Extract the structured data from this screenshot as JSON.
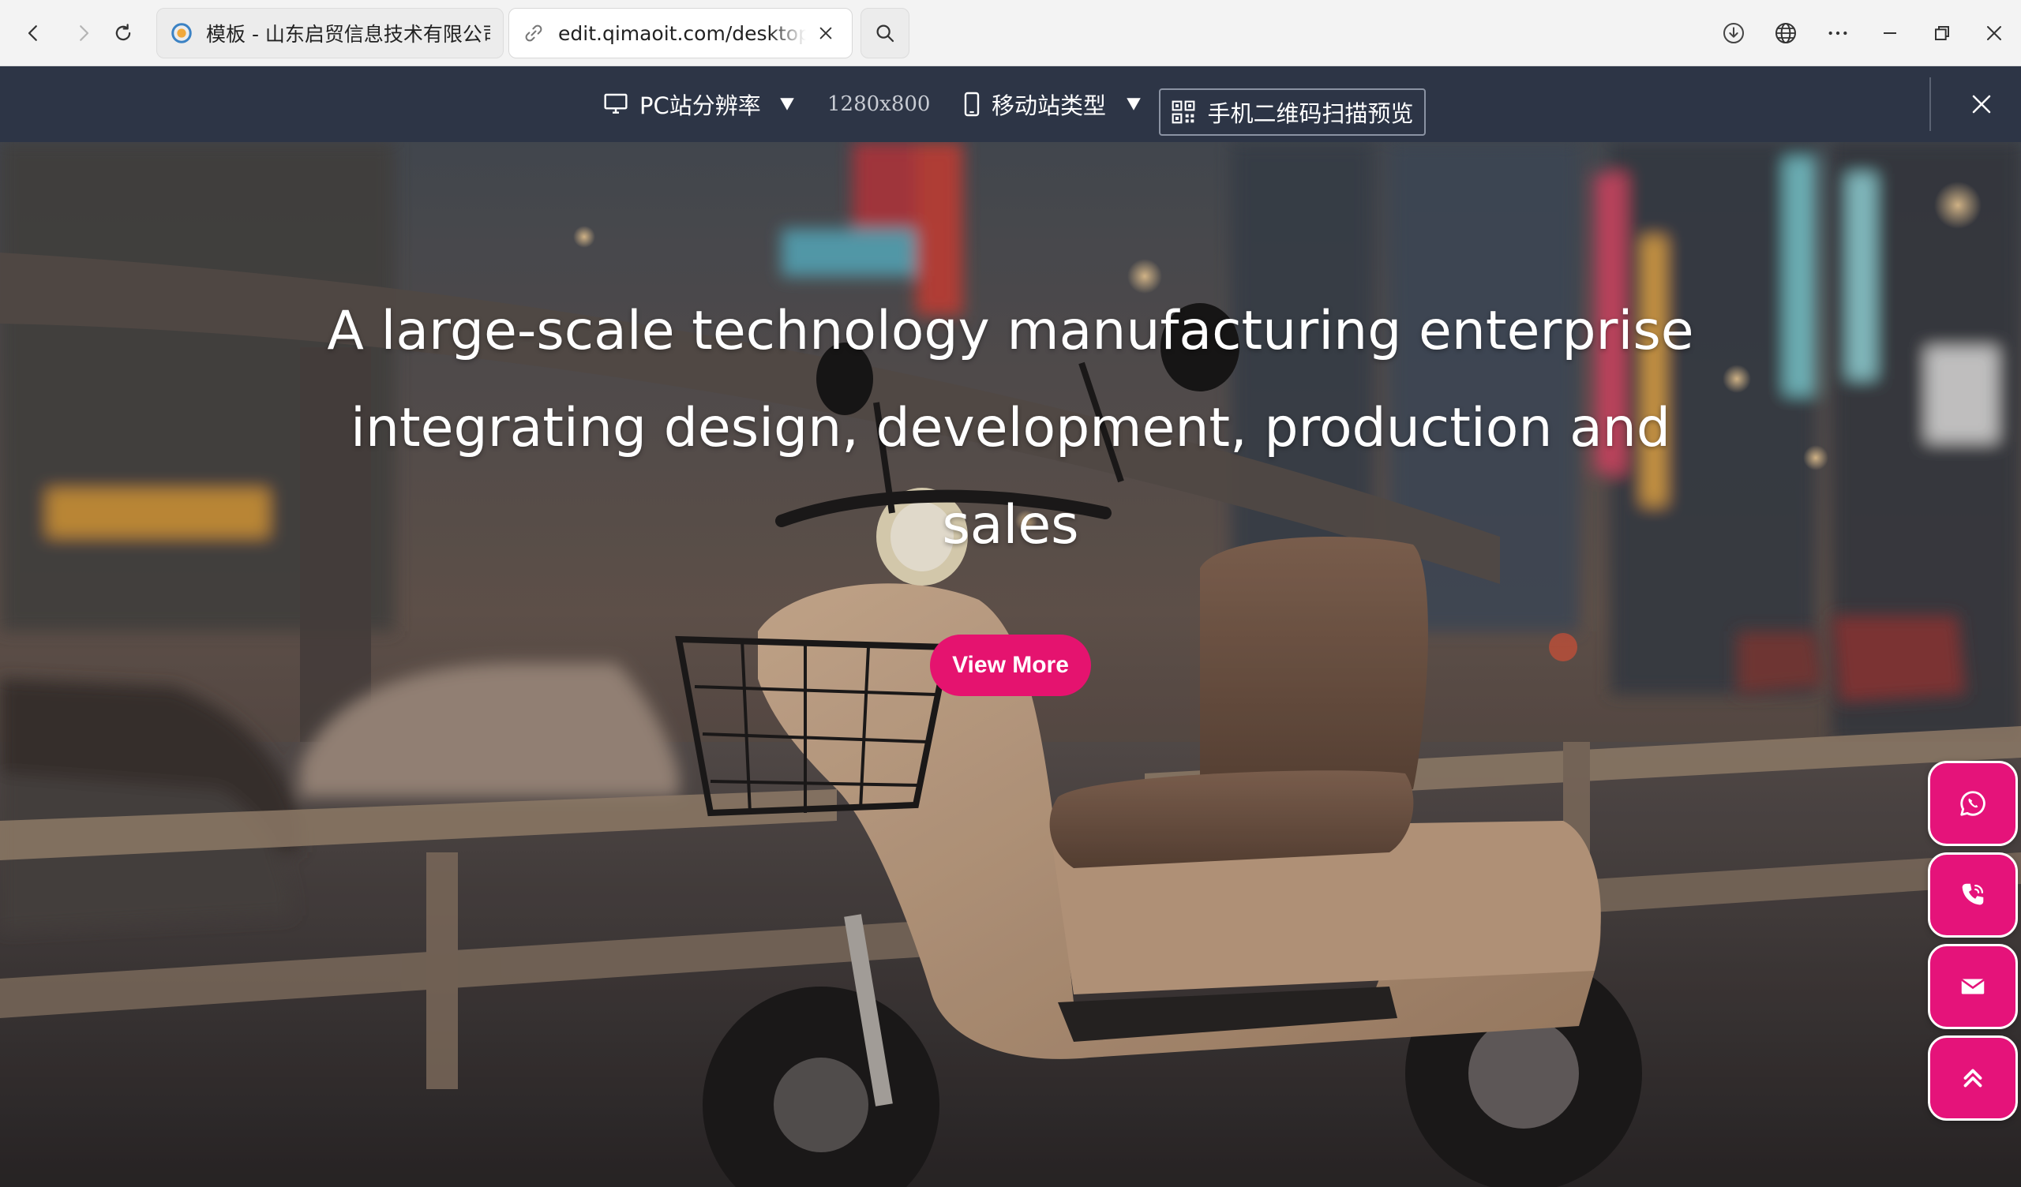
{
  "browser": {
    "tabs": [
      {
        "title": "模板 - 山东启贸信息技术有限公司",
        "active": false
      },
      {
        "title": "edit.qimaoit.com/desktop/h",
        "active": true
      }
    ]
  },
  "editor_toolbar": {
    "pc_resolution_label": "PC站分辨率",
    "resolution_value": "1280x800",
    "mobile_type_label": "移动站类型",
    "qr_preview_label": "手机二维码扫描预览"
  },
  "hero": {
    "title": "A large-scale technology manufacturing enterprise integrating design, development, production and sales",
    "button_label": "View More"
  },
  "floating_buttons": [
    {
      "name": "whatsapp",
      "icon": "whatsapp-icon"
    },
    {
      "name": "phone",
      "icon": "phone-icon"
    },
    {
      "name": "email",
      "icon": "mail-icon"
    },
    {
      "name": "back-to-top",
      "icon": "double-chevron-up-icon"
    }
  ],
  "colors": {
    "accent": "#e5136f",
    "toolbar_bg": "#2d3546",
    "browser_bg": "#f3f3f3"
  }
}
